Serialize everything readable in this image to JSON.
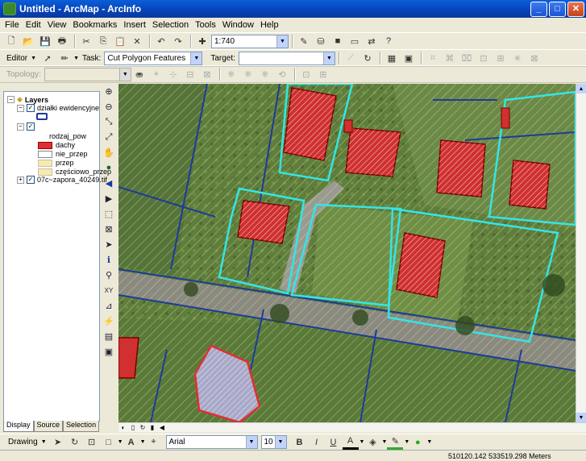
{
  "window": {
    "title": "Untitled - ArcMap - ArcInfo"
  },
  "menu": {
    "items": [
      "File",
      "Edit",
      "View",
      "Bookmarks",
      "Insert",
      "Selection",
      "Tools",
      "Window",
      "Help"
    ]
  },
  "standard_toolbar": {
    "scale": "1:740"
  },
  "editor_toolbar": {
    "editor_label": "Editor",
    "task_label": "Task:",
    "task_value": "Cut Polygon Features",
    "target_label": "Target:",
    "target_value": ""
  },
  "topology_toolbar": {
    "label": "Topology:",
    "value": ""
  },
  "toc": {
    "root": "Layers",
    "layers": [
      {
        "name": "działki ewidencyjne",
        "checked": true
      },
      {
        "name": "",
        "checked": true,
        "field": "rodzaj_pow",
        "classes": [
          {
            "label": "dachy",
            "color": "#e03030"
          },
          {
            "label": "nie_przep",
            "color": "#ffffff"
          },
          {
            "label": "przep",
            "color": "#f4ecae"
          },
          {
            "label": "częściowo_przep",
            "color": "#f4ecae"
          }
        ]
      },
      {
        "name": "07c~zapora_40249.tif",
        "checked": true
      }
    ],
    "tabs": [
      "Display",
      "Source",
      "Selection"
    ]
  },
  "drawing_toolbar": {
    "drawing_label": "Drawing",
    "font": "Arial",
    "font_size": "10",
    "bold": "B",
    "italic": "I",
    "underline": "U",
    "font_color": "A"
  },
  "status": {
    "coordinates": "510120.142  533519.298 Meters"
  },
  "colors": {
    "parcel_outline": "#1e3a9a",
    "selected_outline": "#33e6e6",
    "roof_fill": "#e03030",
    "road": "#8a8a80"
  }
}
